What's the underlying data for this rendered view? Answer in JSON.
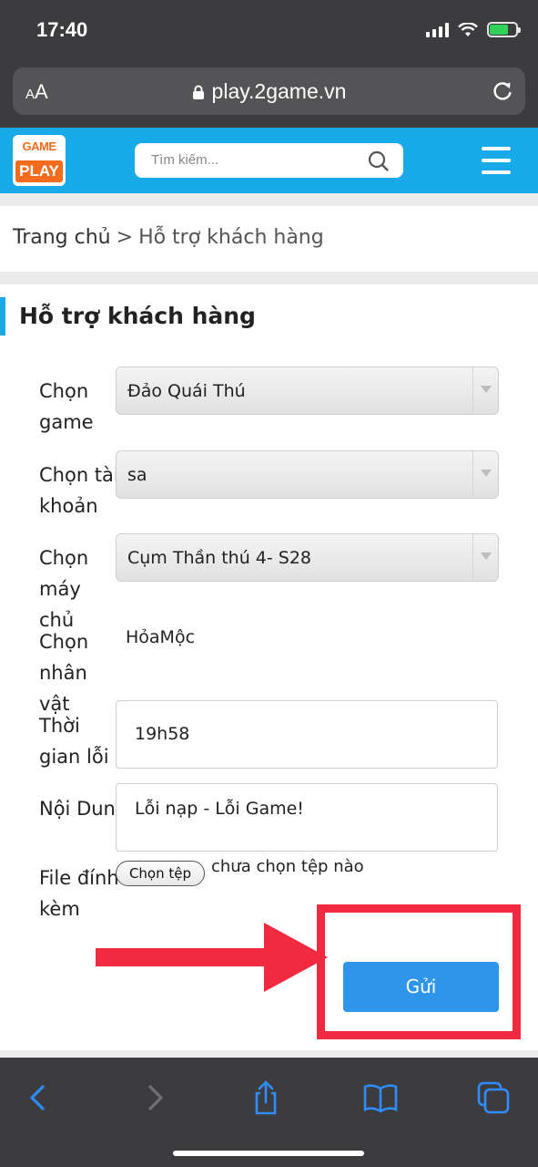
{
  "status_bar": {
    "time": "17:40"
  },
  "browser": {
    "aa_label": "AA",
    "url": "play.2game.vn"
  },
  "site": {
    "logo_top": "GAME",
    "logo_bottom": "PLAY",
    "search_placeholder": "Tìm kiếm..."
  },
  "breadcrumb": {
    "home": "Trang chủ",
    "separator": ">",
    "current": "Hỗ trợ khách hàng"
  },
  "form": {
    "title": "Hỗ trợ khách hàng",
    "game_label": "Chọn game",
    "game_value": "Đảo Quái Thú",
    "account_label": "Chọn tài khoản",
    "account_value": "sa",
    "server_label": "Chọn máy chủ",
    "server_value": "Cụm Thần thú 4- S28",
    "character_label": "Chọn nhân vật",
    "character_value": "HỏaMộc",
    "time_label": "Thời gian lỗi",
    "time_value": "19h58",
    "content_label": "Nội Dung",
    "content_value": "Lỗi nạp - Lỗi Game!",
    "attachment_label": "File đính kèm",
    "choose_file_label": "Chọn tệp",
    "no_file_text": "chưa chọn tệp nào",
    "submit_label": "Gửi"
  },
  "colors": {
    "brand": "#17a9e8",
    "submit": "#2e95ea",
    "annotation": "#f02a40"
  }
}
